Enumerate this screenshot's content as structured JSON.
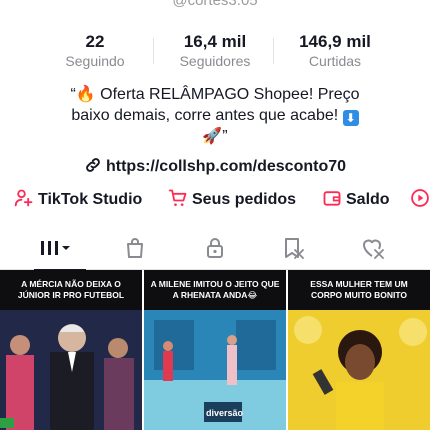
{
  "profile": {
    "handle": "@cortes3.05"
  },
  "stats": [
    {
      "value": "22",
      "label": "Seguindo"
    },
    {
      "value": "16,4 mil",
      "label": "Seguidores"
    },
    {
      "value": "146,9 mil",
      "label": "Curtidas"
    }
  ],
  "bio": {
    "line1": "“🔥 Oferta RELÂMPAGO Shopee! Preço",
    "line2": "baixo demais, corre antes que acabe!",
    "line2_emoji": "⬇",
    "line3": "🚀”"
  },
  "link": {
    "url": "https://collshp.com/desconto70"
  },
  "actions": [
    {
      "label": "TikTok Studio",
      "icon": "person-plus-icon"
    },
    {
      "label": "Seus pedidos",
      "icon": "cart-icon"
    },
    {
      "label": "Saldo",
      "icon": "wallet-icon"
    },
    {
      "label": "",
      "icon": "play-circle-icon"
    }
  ],
  "tabs": [
    {
      "icon": "grid-icon",
      "active": true
    },
    {
      "icon": "shopping-bag-icon",
      "active": false
    },
    {
      "icon": "lock-icon",
      "active": false
    },
    {
      "icon": "bookmark-icon",
      "active": false
    },
    {
      "icon": "liked-heart-icon",
      "active": false
    }
  ],
  "videos": [
    {
      "caption": "A MÉRCIA NÃO DEIXA O JÚNIOR IR PRO FUTEBOL"
    },
    {
      "caption": "A MILENE IMITOU O JEITO QUE A RHENATA ANDA😂"
    },
    {
      "caption": "ESSA MULHER TEM UM CORPO MUITO BONITO"
    }
  ],
  "colors": {
    "accent": "#fe2c55",
    "text": "#161823",
    "muted": "#8a8b91"
  }
}
